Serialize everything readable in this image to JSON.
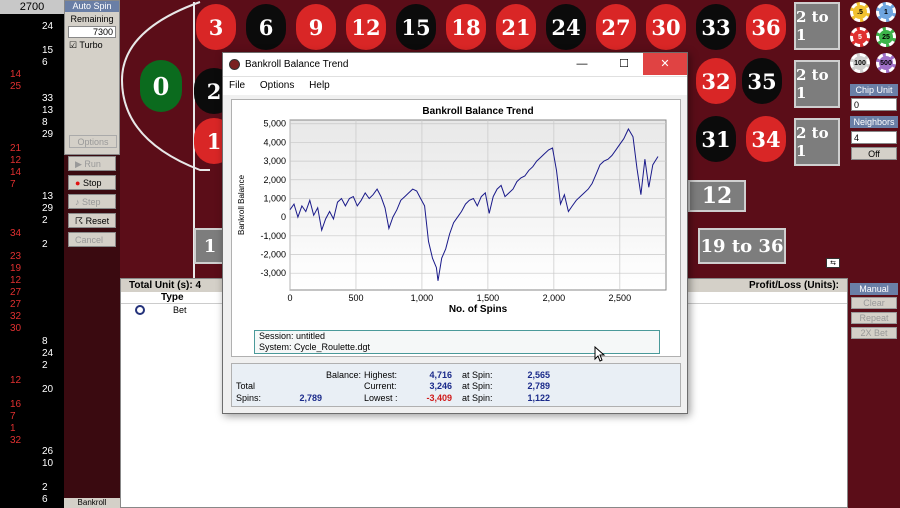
{
  "history": {
    "balance": "2700",
    "red": [
      {
        "v": "14",
        "y": 69
      },
      {
        "v": "25",
        "y": 81
      },
      {
        "v": "21",
        "y": 143
      },
      {
        "v": "12",
        "y": 155
      },
      {
        "v": "14",
        "y": 167
      },
      {
        "v": "7",
        "y": 179
      },
      {
        "v": "34",
        "y": 228
      },
      {
        "v": "23",
        "y": 251
      },
      {
        "v": "19",
        "y": 263
      },
      {
        "v": "12",
        "y": 275
      },
      {
        "v": "27",
        "y": 287
      },
      {
        "v": "27",
        "y": 299
      },
      {
        "v": "32",
        "y": 311
      },
      {
        "v": "30",
        "y": 323
      },
      {
        "v": "12",
        "y": 375
      },
      {
        "v": "16",
        "y": 399
      },
      {
        "v": "7",
        "y": 411
      },
      {
        "v": "1",
        "y": 423
      },
      {
        "v": "32",
        "y": 435
      }
    ],
    "black": [
      {
        "v": "24",
        "y": 21
      },
      {
        "v": "15",
        "y": 45
      },
      {
        "v": "6",
        "y": 57
      },
      {
        "v": "33",
        "y": 93
      },
      {
        "v": "13",
        "y": 105
      },
      {
        "v": "8",
        "y": 117
      },
      {
        "v": "29",
        "y": 129
      },
      {
        "v": "13",
        "y": 191
      },
      {
        "v": "29",
        "y": 203
      },
      {
        "v": "2",
        "y": 215
      },
      {
        "v": "2",
        "y": 239
      },
      {
        "v": "8",
        "y": 336
      },
      {
        "v": "24",
        "y": 348
      },
      {
        "v": "2",
        "y": 360
      },
      {
        "v": "20",
        "y": 384
      },
      {
        "v": "26",
        "y": 446
      },
      {
        "v": "10",
        "y": 458
      },
      {
        "v": "2",
        "y": 482
      },
      {
        "v": "6",
        "y": 494
      }
    ]
  },
  "autospin": {
    "title": "Auto Spin",
    "remaining_label": "Remaining",
    "remaining_value": "7300",
    "turbo_label": "Turbo",
    "options_label": "Options"
  },
  "controls": {
    "run": "Run",
    "stop": "Stop",
    "step": "Step",
    "reset": "Reset",
    "cancel": "Cancel"
  },
  "table": {
    "zero": "0",
    "top_row": [
      {
        "n": "3",
        "c": "r"
      },
      {
        "n": "6",
        "c": "b"
      },
      {
        "n": "9",
        "c": "r"
      },
      {
        "n": "12",
        "c": "r"
      },
      {
        "n": "15",
        "c": "b"
      },
      {
        "n": "18",
        "c": "r"
      },
      {
        "n": "21",
        "c": "r"
      },
      {
        "n": "24",
        "c": "b"
      },
      {
        "n": "27",
        "c": "r"
      },
      {
        "n": "30",
        "c": "r"
      },
      {
        "n": "33",
        "c": "b"
      },
      {
        "n": "36",
        "c": "r"
      }
    ],
    "mid_visible": [
      {
        "n": "2",
        "c": "b"
      },
      {
        "n": "32",
        "c": "r"
      },
      {
        "n": "35",
        "c": "b"
      }
    ],
    "bot_visible": [
      {
        "n": "1",
        "c": "r"
      },
      {
        "n": "31",
        "c": "b"
      },
      {
        "n": "34",
        "c": "r"
      }
    ],
    "two_to_one": "2 to 1",
    "dozen_label": "12",
    "outside_right": "19 to 36",
    "outside_left": "1"
  },
  "right_panel": {
    "chips": [
      ".5",
      "1",
      "5",
      "25",
      "100",
      "500"
    ],
    "chip_unit_label": "Chip Unit",
    "chip_unit_value": "0",
    "neighbors_label": "Neighbors",
    "neighbors_value": "4",
    "off_label": "Off"
  },
  "bottom": {
    "total_units_label": "Total Unit (s):",
    "total_units_value": "4",
    "pl_label": "Profit/Loss (Units):",
    "type_header": "Type",
    "bet_row": "Bet",
    "bankroll_label": "Bankroll"
  },
  "manual": {
    "title": "Manual",
    "clear": "Clear",
    "repeat": "Repeat",
    "x2": "2X Bet"
  },
  "dialog": {
    "title": "Bankroll Balance Trend",
    "menu": [
      "File",
      "Options",
      "Help"
    ],
    "minimize": "—",
    "maximize": "☐",
    "close": "✕",
    "session_line": "Session: untitled",
    "system_line": "System: Cycle_Roulette.dgt",
    "stats": {
      "balance_label": "Balance:",
      "total_label": "Total",
      "spins_label": "Spins:",
      "spins_value": "2,789",
      "highest_label": "Highest:",
      "highest_value": "4,716",
      "current_label": "Current:",
      "current_value": "3,246",
      "lowest_label": "Lowest :",
      "lowest_value": "-3,409",
      "at_spin_label": "at Spin:",
      "highest_spin": "2,565",
      "current_spin": "2,789",
      "lowest_spin": "1,122"
    }
  },
  "chart_data": {
    "type": "line",
    "title": "Bankroll Balance Trend",
    "xlabel": "No. of Spins",
    "ylabel": "Bankroll Balance",
    "xlim": [
      0,
      2850
    ],
    "ylim": [
      -3900,
      5200
    ],
    "xticks": [
      0,
      500,
      1000,
      1500,
      2000,
      2500
    ],
    "xtick_labels": [
      "0",
      "500",
      "1,000",
      "1,500",
      "2,000",
      "2,500"
    ],
    "yticks": [
      5000,
      4000,
      3000,
      2000,
      1000,
      0,
      -1000,
      -2000,
      -3000
    ],
    "ytick_labels": [
      "5,000",
      "4,000",
      "3,000",
      "2,000",
      "1,000",
      "0",
      "-1,000",
      "-2,000",
      "-3,000"
    ],
    "grid": true,
    "series": [
      {
        "color": "#1a1a8a",
        "x": [
          0,
          30,
          60,
          90,
          120,
          150,
          180,
          210,
          240,
          270,
          300,
          330,
          360,
          390,
          420,
          450,
          480,
          510,
          540,
          570,
          600,
          630,
          660,
          690,
          720,
          750,
          780,
          810,
          840,
          870,
          900,
          930,
          960,
          990,
          1020,
          1050,
          1080,
          1110,
          1122,
          1150,
          1180,
          1210,
          1240,
          1270,
          1300,
          1330,
          1360,
          1390,
          1420,
          1450,
          1480,
          1510,
          1540,
          1570,
          1600,
          1630,
          1660,
          1690,
          1720,
          1750,
          1780,
          1810,
          1840,
          1870,
          1900,
          1930,
          1960,
          1990,
          2020,
          2050,
          2080,
          2110,
          2140,
          2170,
          2200,
          2230,
          2260,
          2290,
          2320,
          2350,
          2380,
          2410,
          2440,
          2470,
          2500,
          2530,
          2565,
          2600,
          2630,
          2660,
          2690,
          2720,
          2750,
          2789
        ],
        "y": [
          400,
          700,
          0,
          600,
          300,
          900,
          100,
          500,
          -700,
          -100,
          300,
          -100,
          800,
          1000,
          600,
          1000,
          1100,
          600,
          900,
          1300,
          1000,
          1200,
          1500,
          1100,
          500,
          -600,
          0,
          400,
          900,
          1100,
          1300,
          1500,
          1400,
          1000,
          600,
          -1300,
          -2200,
          -2700,
          -3409,
          -2200,
          -1700,
          -900,
          -300,
          0,
          300,
          700,
          900,
          1000,
          600,
          1100,
          1300,
          200,
          1100,
          1500,
          1700,
          1100,
          1300,
          1500,
          1900,
          2100,
          2200,
          2500,
          2700,
          3000,
          3200,
          3400,
          3600,
          3700,
          2500,
          700,
          1200,
          300,
          600,
          900,
          1100,
          1300,
          1500,
          1800,
          2300,
          2800,
          3000,
          3100,
          3300,
          3600,
          3900,
          4200,
          4716,
          4300,
          2600,
          1200,
          3100,
          1600,
          2800,
          3246
        ]
      }
    ]
  }
}
